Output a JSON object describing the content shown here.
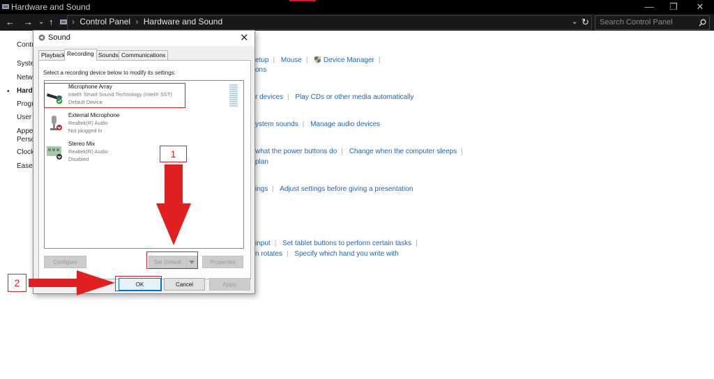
{
  "window": {
    "title": "Hardware and Sound",
    "controls": [
      "—",
      "❐",
      "✕"
    ]
  },
  "address": {
    "path": [
      "Control Panel",
      "Hardware and Sound"
    ],
    "search_placeholder": "Search Control Panel"
  },
  "left_nav": {
    "items": [
      "Contr",
      "Syster",
      "Netwo",
      "Hardw",
      "Progr",
      "User A",
      "Appe",
      "Perso",
      "Clock",
      "Ease c"
    ]
  },
  "content": {
    "row1": {
      "a": "etup",
      "b": "Mouse",
      "c": "Device Manager"
    },
    "row1b": "ons",
    "row2": {
      "a": "r devices",
      "b": "Play CDs or other media automatically"
    },
    "row3": {
      "a": "ystem sounds",
      "b": "Manage audio devices"
    },
    "row4": {
      "a": "what the power buttons do",
      "b": "Change when the computer sleeps"
    },
    "row4b": "plan",
    "row5": {
      "a": "ings",
      "b": "Adjust settings before giving a presentation"
    },
    "row6": {
      "a": "input",
      "b": "Set tablet buttons to perform certain tasks"
    },
    "row6b": {
      "a": "n rotates",
      "b": "Specify which hand you write with"
    }
  },
  "dialog": {
    "title": "Sound",
    "tabs": [
      "Playback",
      "Recording",
      "Sounds",
      "Communications"
    ],
    "selected_tab": "Recording",
    "instruction": "Select a recording device below to modify its settings:",
    "devices": [
      {
        "name": "Microphone Array",
        "driver": "Intel® Smart Sound Technology (Intel® SST)",
        "status": "Default Device"
      },
      {
        "name": "External Microphone",
        "driver": "Realtek(R) Audio",
        "status": "Not plugged in"
      },
      {
        "name": "Stereo Mix",
        "driver": "Realtek(R) Audio",
        "status": "Disabled"
      }
    ],
    "buttons": {
      "configure": "Configure",
      "set_default": "Set Default",
      "properties": "Properties",
      "ok": "OK",
      "cancel": "Cancel",
      "apply": "Apply"
    }
  },
  "annotations": {
    "step1": "1",
    "step2": "2",
    "color": "#e02020"
  }
}
